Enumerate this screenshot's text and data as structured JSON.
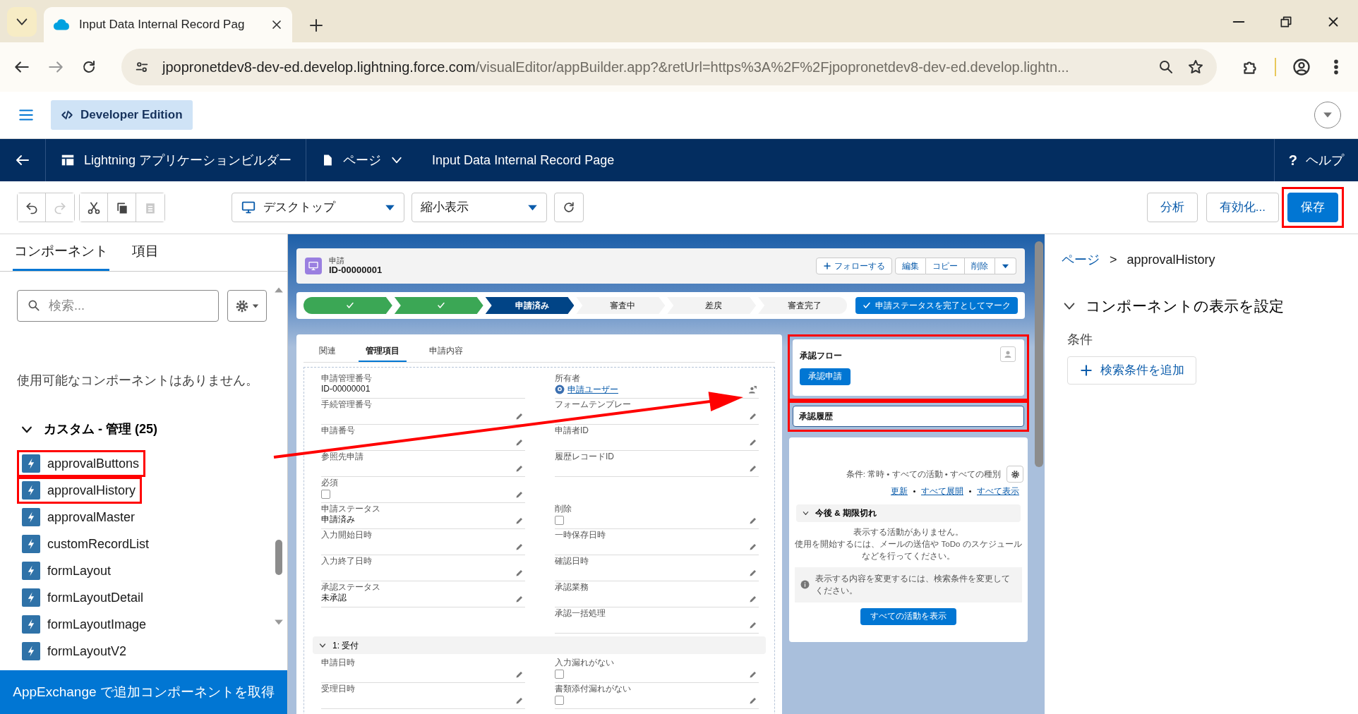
{
  "browser": {
    "tab_title": "Input Data Internal Record Pag",
    "url_host": "jpopronetdev8-dev-ed.develop.lightning.force.com",
    "url_rest": "/visualEditor/appBuilder.app?&retUrl=https%3A%2F%2Fjpopronetdev8-dev-ed.develop.lightn..."
  },
  "org_bar": {
    "edition": "Developer Edition"
  },
  "builder_header": {
    "app_name": "Lightning アプリケーションビルダー",
    "page_menu": "ページ",
    "page_title": "Input Data Internal Record Page",
    "help_icon": "?",
    "help": "ヘルプ"
  },
  "toolbar": {
    "history_buttons": [
      {
        "kind": "undo",
        "disabled": false
      },
      {
        "kind": "redo",
        "disabled": true
      }
    ],
    "edit_buttons": [
      {
        "kind": "cut",
        "disabled": false
      },
      {
        "kind": "copy",
        "disabled": false
      },
      {
        "kind": "paste",
        "disabled": true
      }
    ],
    "device": "デスクトップ",
    "view": "縮小表示",
    "actions": [
      {
        "label": "分析",
        "primary": false,
        "highlighted": false
      },
      {
        "label": "有効化...",
        "primary": false,
        "highlighted": false
      },
      {
        "label": "保存",
        "primary": true,
        "highlighted": true
      }
    ]
  },
  "left_panel": {
    "tabs": [
      {
        "label": "コンポーネント",
        "selected": true
      },
      {
        "label": "項目",
        "selected": false
      }
    ],
    "search": {
      "placeholder": "検索..."
    },
    "empty_message": "使用可能なコンポーネントはありません。",
    "group": {
      "title": "カスタム - 管理 (25)",
      "expanded": true,
      "items": [
        {
          "label": "approvalButtons",
          "highlighted": true
        },
        {
          "label": "approvalHistory",
          "highlighted": true
        },
        {
          "label": "approvalMaster",
          "highlighted": false
        },
        {
          "label": "customRecordList",
          "highlighted": false
        },
        {
          "label": "formLayout",
          "highlighted": false
        },
        {
          "label": "formLayoutDetail",
          "highlighted": false
        },
        {
          "label": "formLayoutImage",
          "highlighted": false
        },
        {
          "label": "formLayoutV2",
          "highlighted": false
        }
      ]
    },
    "footer": "AppExchange で追加コンポーネントを取得"
  },
  "canvas": {
    "record": {
      "object": "申請",
      "name": "ID-00000001",
      "follow": "フォローする",
      "actions": [
        "編集",
        "コピー",
        "削除"
      ],
      "path": [
        {
          "complete": true,
          "selected": false
        },
        {
          "complete": true,
          "selected": false
        },
        {
          "label": "申請済み",
          "complete": false,
          "selected": true
        },
        {
          "label": "審査中",
          "complete": false,
          "selected": false
        },
        {
          "label": "差戻",
          "complete": false,
          "selected": false
        },
        {
          "label": "審査完了",
          "complete": false,
          "selected": false
        }
      ],
      "path_button": "申請ステータスを完了としてマーク"
    },
    "detail": {
      "tabs": [
        {
          "label": "関連",
          "selected": false
        },
        {
          "label": "管理項目",
          "selected": true
        },
        {
          "label": "申請内容",
          "selected": false
        }
      ],
      "rows": [
        {
          "left": {
            "label": "申請管理番号",
            "kind": "text",
            "value": "ID-00000001",
            "editable": false
          },
          "right": {
            "label": "所有者",
            "kind": "user",
            "value": "申請ユーザー",
            "editable": true
          }
        },
        {
          "left": {
            "label": "手続管理番号",
            "editable": true
          },
          "right": {
            "label": "フォームテンプレー",
            "editable": true
          }
        },
        {
          "left": {
            "label": "申請番号",
            "editable": true
          },
          "right": {
            "label": "申請者ID",
            "editable": true
          }
        },
        {
          "left": {
            "label": "参照先申請",
            "editable": true
          },
          "right": {
            "label": "履歴レコードID",
            "editable": true
          }
        },
        {
          "left": {
            "label": "必須",
            "kind": "checkbox",
            "checked": false,
            "editable": true
          }
        },
        {
          "left": {
            "label": "申請ステータス",
            "kind": "text",
            "value": "申請済み",
            "editable": true
          },
          "right": {
            "label": "削除",
            "kind": "checkbox",
            "checked": false,
            "editable": true
          }
        },
        {
          "left": {
            "label": "入力開始日時",
            "editable": true
          },
          "right": {
            "label": "一時保存日時",
            "editable": true
          }
        },
        {
          "left": {
            "label": "入力終了日時",
            "editable": true
          },
          "right": {
            "label": "確認日時",
            "editable": true
          }
        },
        {
          "left": {
            "label": "承認ステータス",
            "kind": "text",
            "value": "未承認",
            "editable": true
          },
          "right": {
            "label": "承認業務",
            "editable": true
          }
        },
        {
          "right": {
            "label": "承認一括処理",
            "editable": true
          }
        }
      ],
      "sections": [
        {
          "title": "1: 受付",
          "expanded": true,
          "rows": [
            {
              "left": {
                "label": "申請日時",
                "editable": true
              },
              "right": {
                "label": "入力漏れがない",
                "kind": "checkbox",
                "checked": false,
                "editable": true
              }
            },
            {
              "left": {
                "label": "受理日時",
                "editable": true
              },
              "right": {
                "label": "書類添付漏れがない",
                "kind": "checkbox",
                "checked": false,
                "editable": true
              }
            }
          ]
        }
      ]
    },
    "approval_flow": {
      "title": "承認フロー",
      "button": "承認申請",
      "highlighted": true,
      "selected": false
    },
    "approval_history": {
      "title": "承認履歴",
      "highlighted": true,
      "selected": true
    },
    "activity": {
      "filter": "条件: 常時 • すべての活動 • すべての種別",
      "links": [
        "更新",
        "すべて展開",
        "すべて表示"
      ],
      "section": {
        "title": "今後 & 期限切れ",
        "expanded": true
      },
      "empty": "表示する活動がありません。",
      "hint": "使用を開始するには、メールの送信や ToDo のスケジュールなどを行ってください。",
      "info": "表示する内容を変更するには、検索条件を変更してください。",
      "button": "すべての活動を表示"
    }
  },
  "right_panel": {
    "breadcrumb": [
      "ページ",
      "approvalHistory"
    ],
    "separator": ">",
    "section": {
      "title": "コンポーネントの表示を設定",
      "expanded": true
    },
    "conditions_label": "条件",
    "add_button": "検索条件を追加"
  }
}
